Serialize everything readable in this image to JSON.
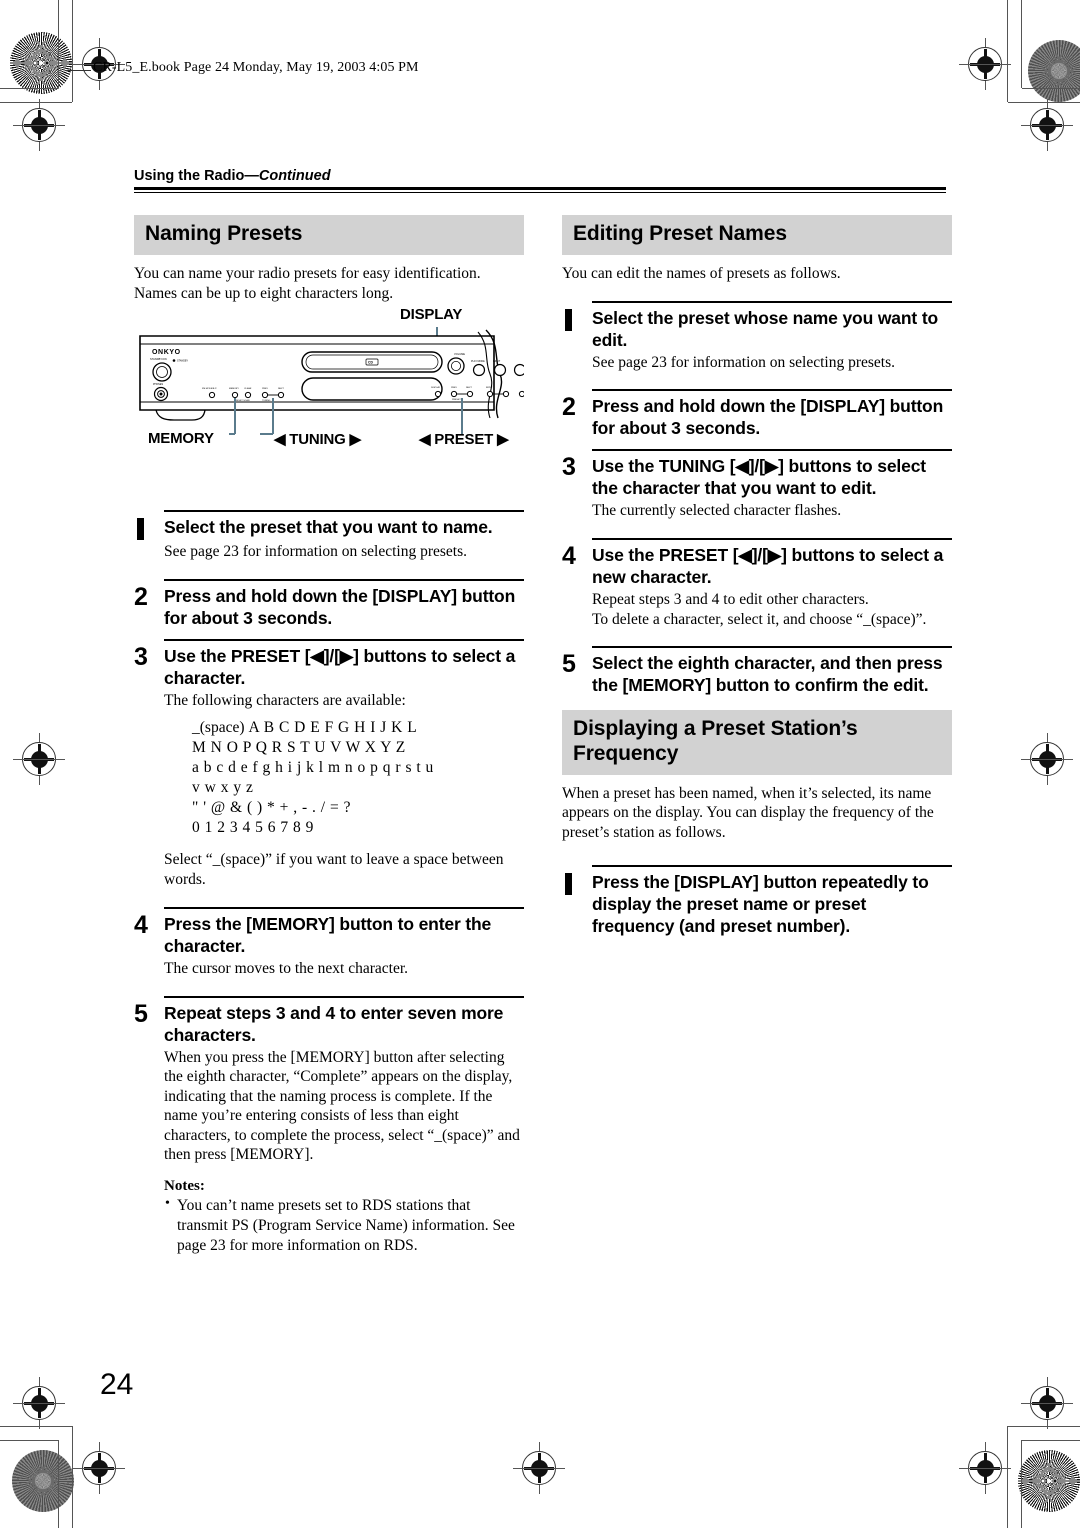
{
  "page": {
    "file_header": "CR-L5_E.book  Page 24  Monday, May 19, 2003  4:05 PM",
    "running_head_bold": "Using the Radio",
    "running_head_dash": "—",
    "running_head_italic": "Continued",
    "page_number": "24",
    "accent_bar_color": "#d2d2d2"
  },
  "figure": {
    "brand": "ONKYO",
    "labels": {
      "display": "DISPLAY",
      "memory": "MEMORY",
      "tuning": "◀ TUNING ▶",
      "preset": "◀ PRESET ▶"
    }
  },
  "left_column": {
    "section_title": "Naming Presets",
    "intro": "You can name your radio presets for easy identification. Names can be up to eight characters long.",
    "steps": [
      {
        "num": "1",
        "head": "Select the preset that you want to name.",
        "body": [
          "See page 23 for information on selecting presets."
        ]
      },
      {
        "num": "2",
        "head": "Press and hold down the [DISPLAY] button for about 3 seconds.",
        "body": []
      },
      {
        "num": "3",
        "head": "Use the PRESET [◀]/[▶] buttons to select a character.",
        "body": [
          "The following characters are available:"
        ]
      },
      {
        "num": "4",
        "head": "Press the [MEMORY] button to enter the character.",
        "body": [
          "The cursor moves to the next character."
        ]
      },
      {
        "num": "5",
        "head": "Repeat steps 3 and 4 to enter seven more characters.",
        "body": [
          "When you press the [MEMORY] button after selecting the eighth character, “Complete” appears on the display, indicating that the naming process is complete. If the name you’re entering consists of less than eight characters, to complete the process, select “_(space)” and then press [MEMORY]."
        ]
      }
    ],
    "character_list": [
      "_(space) A B C D E F G H I J K L",
      "M N O P Q R S T U V W X Y Z",
      "a b c d e f g h i j k l m n o p q r s t u",
      "v w x y z",
      "\" ' @ & ( ) * + , - . / = ?",
      "0 1 2 3 4 5 6 7 8 9"
    ],
    "space_note": "Select “_(space)” if you want to leave a space between words.",
    "notes_label": "Notes:",
    "notes": [
      "You can’t name presets set to RDS stations that transmit PS (Program Service Name) information. See page 23 for more information on RDS."
    ]
  },
  "right_column": {
    "section_title": "Editing Preset Names",
    "intro": "You can edit the names of presets as follows.",
    "steps": [
      {
        "num": "1",
        "head": "Select the preset whose name you want to edit.",
        "body": [
          "See page 23 for information on selecting presets."
        ]
      },
      {
        "num": "2",
        "head": "Press and hold down the [DISPLAY] button for about 3 seconds.",
        "body": []
      },
      {
        "num": "3",
        "head": "Use the TUNING [◀]/[▶] buttons to select the character that you want to edit.",
        "body": [
          "The currently selected character flashes."
        ]
      },
      {
        "num": "4",
        "head": "Use the PRESET [◀]/[▶] buttons to select a new character.",
        "body": [
          "Repeat steps 3 and 4 to edit other characters.",
          "To delete a character, select it, and choose “_(space)”."
        ]
      },
      {
        "num": "5",
        "head": "Select the eighth character, and then press the [MEMORY] button to confirm the edit.",
        "body": []
      }
    ],
    "section2_title": "Displaying a Preset Station’s Frequency",
    "section2_intro": "When a preset has been named, when it’s selected, its name appears on the display. You can display the frequency of the preset’s station as follows.",
    "section2_steps": [
      {
        "num": "1",
        "head": "Press the [DISPLAY] button repeatedly to display the preset name or preset frequency (and preset number).",
        "body": []
      }
    ]
  }
}
